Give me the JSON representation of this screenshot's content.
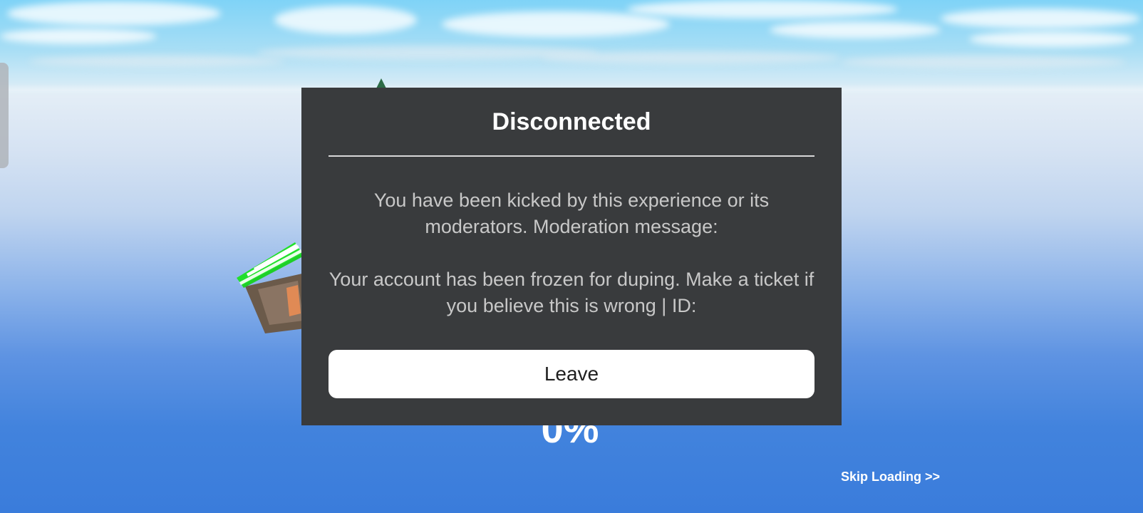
{
  "background": {
    "loading_progress": "0%",
    "skip_loading_label": "Skip Loading >>"
  },
  "dialog": {
    "title": "Disconnected",
    "message_lines": [
      "You have been kicked by this experience or its moderators. Moderation message:",
      "Your account has been frozen for duping. Make a ticket if you believe this is wrong | ID:"
    ],
    "leave_label": "Leave"
  },
  "colors": {
    "dialog_background": "#393b3d",
    "dialog_title": "#ffffff",
    "dialog_text": "#c8c8c8",
    "button_background": "#ffffff",
    "sky_top": "#7fd3f7",
    "sky_bottom": "#3a7cdb"
  },
  "icons": {
    "stall_object": "green-striped-market-stall",
    "tree_object": "pine-tree-tip"
  }
}
